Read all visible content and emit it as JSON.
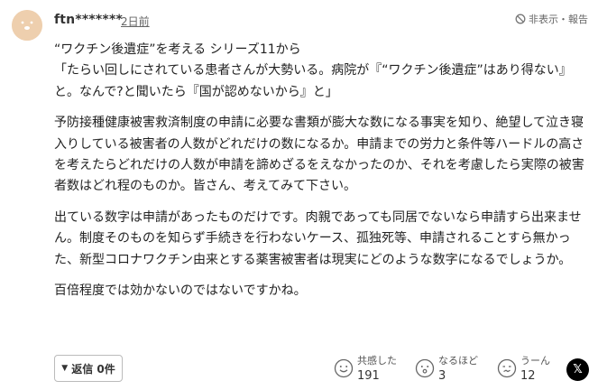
{
  "comment": {
    "user_name": "ftn*******",
    "posted": "2日前",
    "report_label": "非表示・報告",
    "paragraphs": [
      "“ワクチン後遺症”を考える シリーズ11から\n「たらい回しにされている患者さんが大勢いる。病院が『“ワクチン後遺症”はあり得ない』と。なんで?と聞いたら『国が認めないから』と」",
      "予防接種健康被害救済制度の申請に必要な書類が膨大な数になる事実を知り、絶望して泣き寝入りしている被害者の人数がどれだけの数になるか。申請までの労力と条件等ハードルの高さを考えたらどれだけの人数が申請を諦めざるをえなかったのか、それを考慮したら実際の被害者数はどれ程のものか。皆さん、考えてみて下さい。",
      "出ている数字は申請があったものだけです。肉親であっても同居でないなら申請すら出来ません。制度そのものを知らず手続きを行わないケース、孤独死等、申請されることすら無かった、新型コロナワクチン由来とする薬害被害者は現実にどのような数字になるでしょうか。",
      "百倍程度では効かないのではないですかね。"
    ]
  },
  "footer": {
    "reply_label": "返信 0件",
    "reply_icon": "triangle-down-icon",
    "reactions": [
      {
        "icon": "empathy-face-icon",
        "label": "共感した",
        "count": "191"
      },
      {
        "icon": "insightful-face-icon",
        "label": "なるほど",
        "count": "3"
      },
      {
        "icon": "hmm-face-icon",
        "label": "うーん",
        "count": "12"
      }
    ],
    "share_x_label": "𝕏"
  },
  "colors": {
    "avatar_bg": "#eecfae",
    "text": "#222222",
    "muted": "#666666",
    "border": "#bbbbbb"
  }
}
